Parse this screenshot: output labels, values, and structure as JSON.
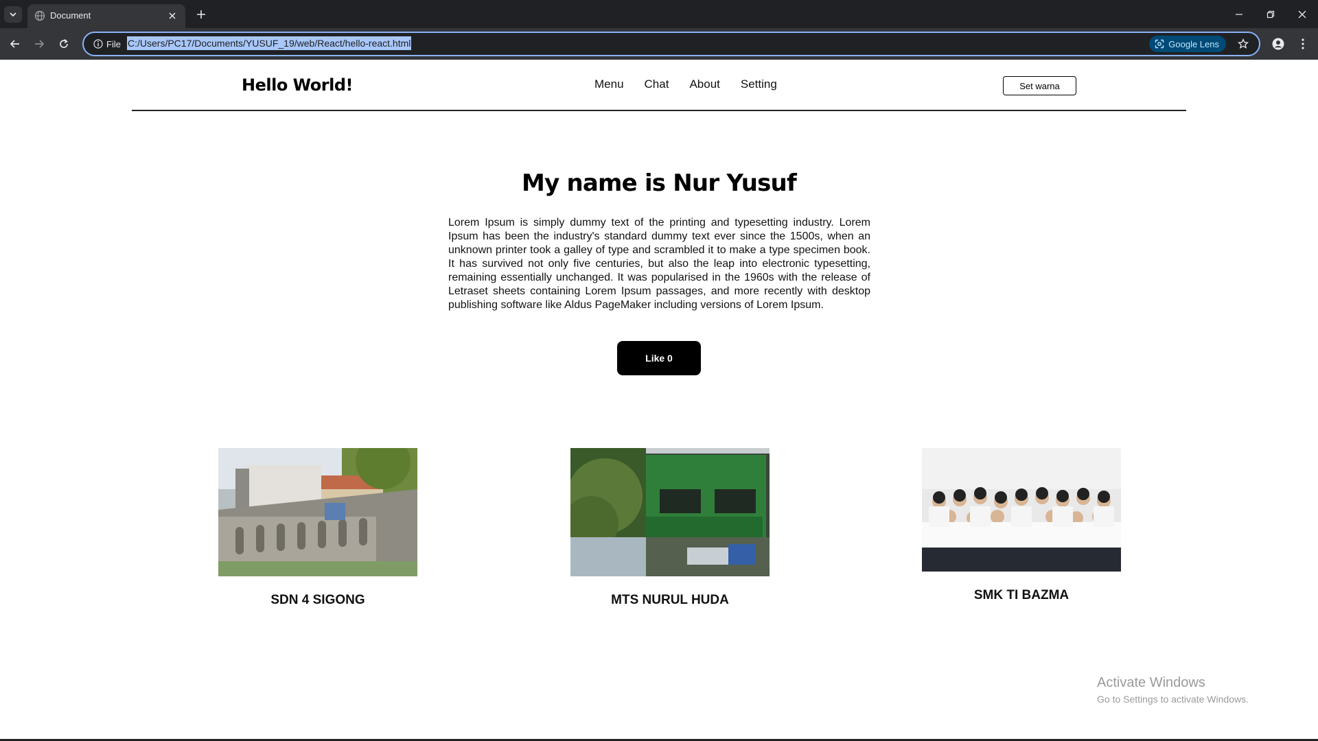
{
  "browser": {
    "tab_title": "Document",
    "site_info_label": "File",
    "url": "C:/Users/PC17/Documents/YUSUF_19/web/React/hello-react.html",
    "lens_label": "Google Lens"
  },
  "header": {
    "brand": "Hello World!",
    "nav": [
      "Menu",
      "Chat",
      "About",
      "Setting"
    ],
    "set_color_button": "Set warna"
  },
  "hero": {
    "title": "My name is Nur Yusuf",
    "text": "Lorem Ipsum is simply dummy text of the printing and typesetting industry. Lorem Ipsum has been the industry's standard dummy text ever since the 1500s, when an unknown printer took a galley of type and scrambled it to make a type specimen book. It has survived not only five centuries, but also the leap into electronic typesetting, remaining essentially unchanged. It was popularised in the 1960s with the release of Letraset sheets containing Lorem Ipsum passages, and more recently with desktop publishing software like Aldus PageMaker including versions of Lorem Ipsum.",
    "like_button": "Like 0"
  },
  "schools": [
    {
      "name": "SDN 4 SIGONG"
    },
    {
      "name": "MTS NURUL HUDA"
    },
    {
      "name": "SMK TI BAZMA"
    }
  ],
  "watermark": {
    "title": "Activate Windows",
    "subtitle": "Go to Settings to activate Windows."
  },
  "colors": {
    "omnibox_border": "#8ab4f8",
    "url_selection": "#a8c7fa",
    "like_button_bg": "#000000"
  }
}
